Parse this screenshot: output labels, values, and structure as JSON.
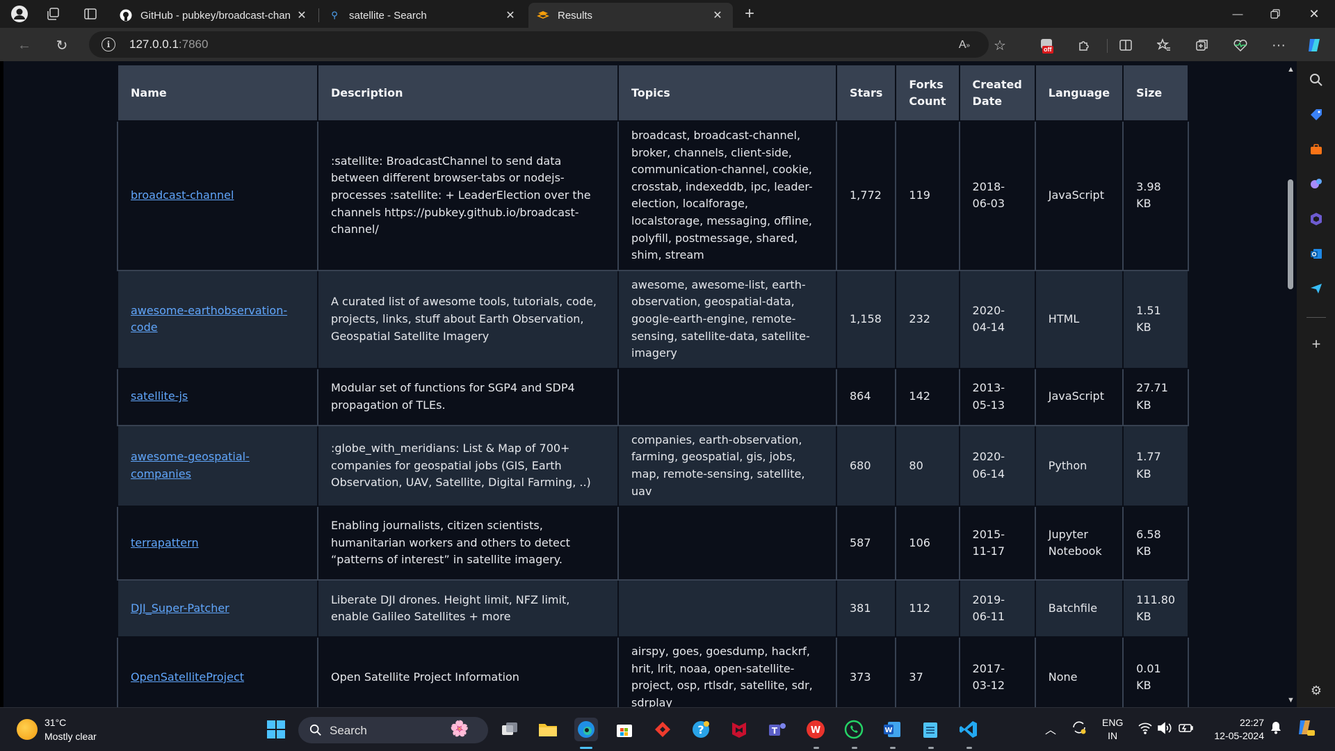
{
  "browser": {
    "tabs": [
      {
        "title": "GitHub - pubkey/broadcast-chan",
        "favicon": "github-icon",
        "active": false
      },
      {
        "title": "satellite - Search",
        "favicon": "search-icon",
        "active": false
      },
      {
        "title": "Results",
        "favicon": "gradio-icon",
        "active": true
      }
    ],
    "url_host": "127.0.0.1",
    "url_port": ":7860",
    "extension_badge": "off"
  },
  "table": {
    "headers": [
      "Name",
      "Description",
      "Topics",
      "Stars",
      "Forks Count",
      "Created Date",
      "Language",
      "Size"
    ],
    "rows": [
      {
        "name": "broadcast-channel",
        "description": ":satellite: BroadcastChannel to send data between different browser-tabs or nodejs-processes :satellite: + LeaderElection over the channels https://pubkey.github.io/broadcast-channel/",
        "topics": "broadcast, broadcast-channel, broker, channels, client-side, communication-channel, cookie, crosstab, indexeddb, ipc, leader-election, localforage, localstorage, messaging, offline, polyfill, postmessage, shared, shim, stream",
        "stars": "1,772",
        "forks": "119",
        "created": "2018-06-03",
        "language": "JavaScript",
        "size": "3.98 KB"
      },
      {
        "name": "awesome-earthobservation-code",
        "description": "A curated list of awesome tools, tutorials, code, projects, links, stuff about Earth Observation, Geospatial Satellite Imagery",
        "topics": "awesome, awesome-list, earth-observation, geospatial-data, google-earth-engine, remote-sensing, satellite-data, satellite-imagery",
        "stars": "1,158",
        "forks": "232",
        "created": "2020-04-14",
        "language": "HTML",
        "size": "1.51 KB"
      },
      {
        "name": "satellite-js",
        "description": "Modular set of functions for SGP4 and SDP4 propagation of TLEs.",
        "topics": "",
        "stars": "864",
        "forks": "142",
        "created": "2013-05-13",
        "language": "JavaScript",
        "size": "27.71 KB"
      },
      {
        "name": "awesome-geospatial-companies",
        "description": ":globe_with_meridians: List & Map of 700+ companies for geospatial jobs (GIS, Earth Observation, UAV, Satellite, Digital Farming, ..)",
        "topics": "companies, earth-observation, farming, geospatial, gis, jobs, map, remote-sensing, satellite, uav",
        "stars": "680",
        "forks": "80",
        "created": "2020-06-14",
        "language": "Python",
        "size": "1.77 KB"
      },
      {
        "name": "terrapattern",
        "description": "Enabling journalists, citizen scientists, humanitarian workers and others to detect “patterns of interest” in satellite imagery.",
        "topics": "",
        "stars": "587",
        "forks": "106",
        "created": "2015-11-17",
        "language": "Jupyter Notebook",
        "size": "6.58 KB"
      },
      {
        "name": "DJI_Super-Patcher",
        "description": "Liberate DJI drones. Height limit, NFZ limit, enable Galileo Satellites + more",
        "topics": "",
        "stars": "381",
        "forks": "112",
        "created": "2019-06-11",
        "language": "Batchfile",
        "size": "111.80 KB"
      },
      {
        "name": "OpenSatelliteProject",
        "description": "Open Satellite Project Information",
        "topics": "airspy, goes, goesdump, hackrf, hrit, lrit, noaa, open-satellite-project, osp, rtlsdr, satellite, sdr, sdrplay",
        "stars": "373",
        "forks": "37",
        "created": "2017-03-12",
        "language": "None",
        "size": "0.01 KB"
      },
      {
        "name": "",
        "description": "",
        "topics": "",
        "stars": "",
        "forks": "",
        "created": "",
        "language": "",
        "size": ""
      }
    ]
  },
  "taskbar": {
    "weather_temp": "31°C",
    "weather_desc": "Mostly clear",
    "search_label": "Search",
    "lang_top": "ENG",
    "lang_bottom": "IN",
    "time": "22:27",
    "date": "12-05-2024"
  }
}
